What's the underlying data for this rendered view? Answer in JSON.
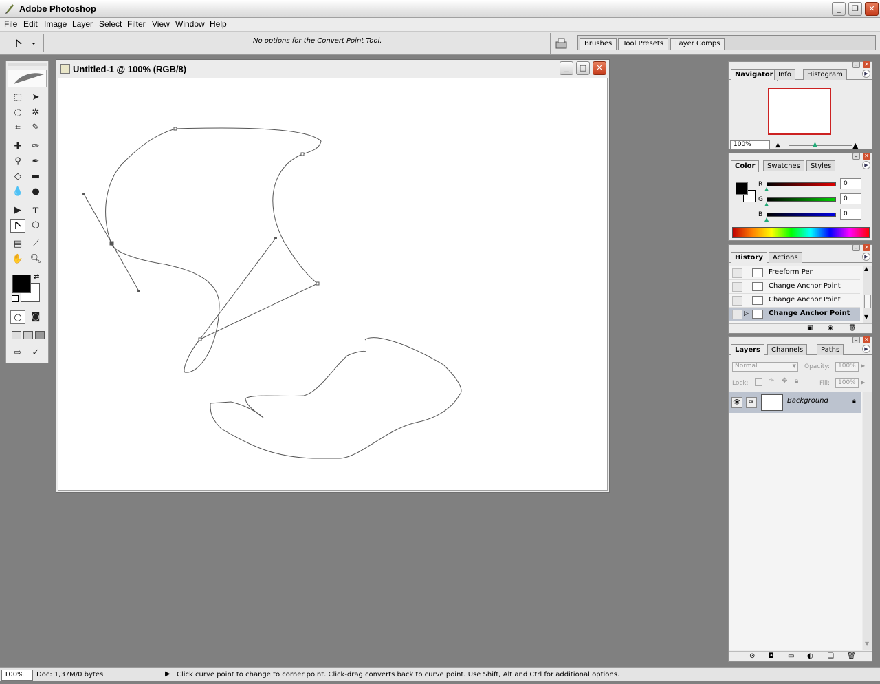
{
  "app": {
    "title": "Adobe Photoshop"
  },
  "menu": [
    "File",
    "Edit",
    "Image",
    "Layer",
    "Select",
    "Filter",
    "View",
    "Window",
    "Help"
  ],
  "options_bar": {
    "message": "No options for the Convert Point Tool."
  },
  "palette_well": {
    "tabs": [
      "Brushes",
      "Tool Presets",
      "Layer Comps"
    ]
  },
  "document": {
    "title": "Untitled-1 @ 100% (RGB/8)"
  },
  "navigator": {
    "tabs": [
      "Navigator",
      "Info",
      "Histogram"
    ],
    "zoom": "100%"
  },
  "color": {
    "tabs": [
      "Color",
      "Swatches",
      "Styles"
    ],
    "channels": [
      {
        "label": "R",
        "value": "0",
        "color": "#cc0000"
      },
      {
        "label": "G",
        "value": "0",
        "color": "#00aa00"
      },
      {
        "label": "B",
        "value": "0",
        "color": "#0000cc"
      }
    ]
  },
  "history": {
    "tabs": [
      "History",
      "Actions"
    ],
    "items": [
      "Freeform Pen",
      "Change Anchor Point",
      "Change Anchor Point",
      "Change Anchor Point"
    ]
  },
  "layers": {
    "tabs": [
      "Layers",
      "Channels",
      "Paths"
    ],
    "blend_mode": "Normal",
    "opacity_label": "Opacity:",
    "opacity": "100%",
    "lock_label": "Lock:",
    "fill_label": "Fill:",
    "fill": "100%",
    "layer_name": "Background"
  },
  "status": {
    "zoom": "100%",
    "doc": "Doc: 1,37M/0 bytes",
    "hint": "Click curve point to change to corner point. Click-drag converts back to curve point.  Use Shift, Alt and Ctrl for additional options."
  }
}
